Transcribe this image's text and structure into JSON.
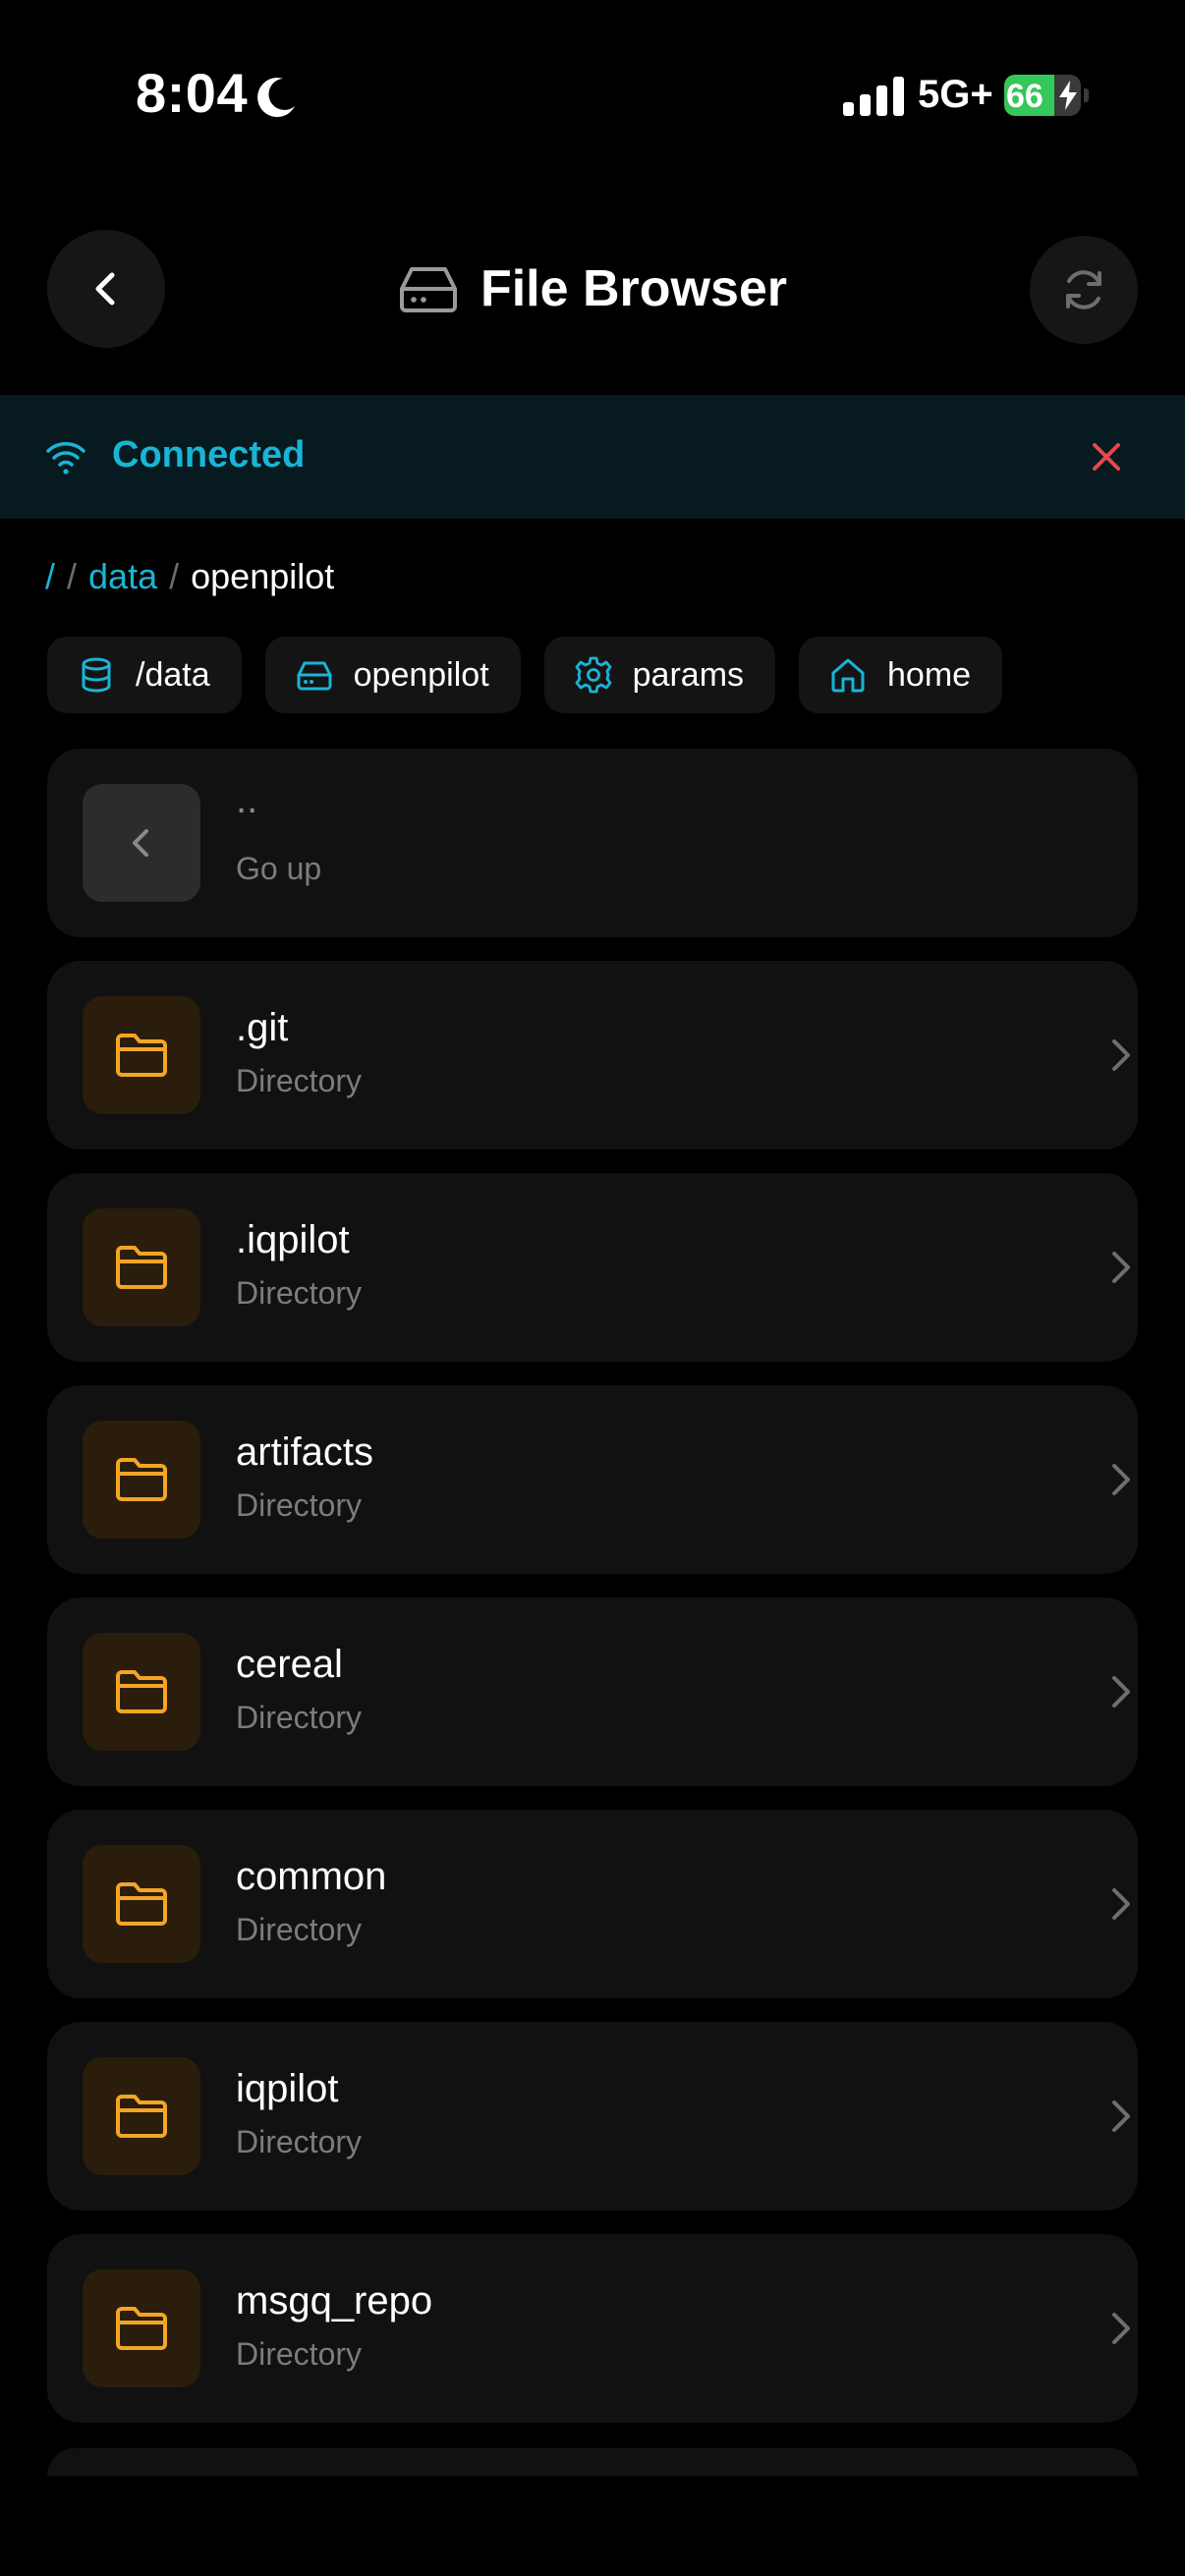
{
  "status_bar": {
    "time": "8:04",
    "network": "5G+",
    "battery": "66",
    "battery_level": 0.66
  },
  "header": {
    "title": "File Browser"
  },
  "banner": {
    "text": "Connected"
  },
  "breadcrumb": {
    "root": "/",
    "sep": "/",
    "parent": "data",
    "current": "openpilot"
  },
  "chips": [
    {
      "label": "/data",
      "icon": "database-icon"
    },
    {
      "label": "openpilot",
      "icon": "drive-icon"
    },
    {
      "label": "params",
      "icon": "gear-icon"
    },
    {
      "label": "home",
      "icon": "home-icon"
    }
  ],
  "go_up": {
    "name": "..",
    "label": "Go up"
  },
  "entries": [
    {
      "name": ".git",
      "type": "Directory"
    },
    {
      "name": ".iqpilot",
      "type": "Directory"
    },
    {
      "name": "artifacts",
      "type": "Directory"
    },
    {
      "name": "cereal",
      "type": "Directory"
    },
    {
      "name": "common",
      "type": "Directory"
    },
    {
      "name": "iqpilot",
      "type": "Directory"
    },
    {
      "name": "msgq_repo",
      "type": "Directory"
    }
  ],
  "colors": {
    "accent": "#19b5d6",
    "folder": "#f5a524",
    "danger": "#e5484d",
    "battery": "#34c759"
  }
}
